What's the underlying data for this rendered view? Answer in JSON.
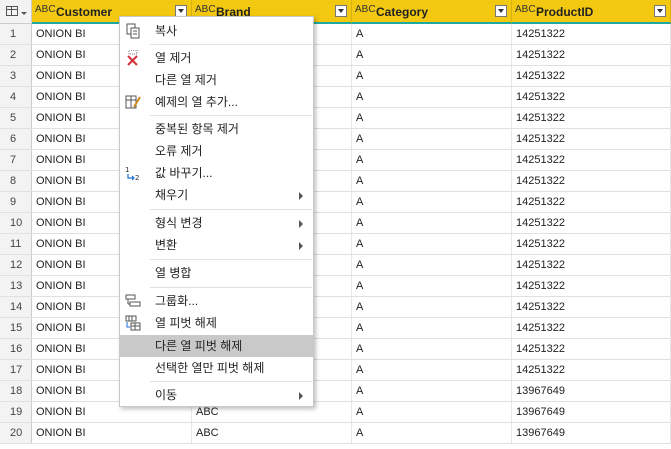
{
  "columns": [
    {
      "type": "ABC",
      "name": "Customer"
    },
    {
      "type": "ABC",
      "name": "Brand"
    },
    {
      "type": "ABC",
      "name": "Category"
    },
    {
      "type": "ABC",
      "name": "ProductID"
    }
  ],
  "rows": [
    [
      "1",
      "ONION BI",
      "",
      "A",
      "14251322"
    ],
    [
      "2",
      "ONION BI",
      "",
      "A",
      "14251322"
    ],
    [
      "3",
      "ONION BI",
      "",
      "A",
      "14251322"
    ],
    [
      "4",
      "ONION BI",
      "",
      "A",
      "14251322"
    ],
    [
      "5",
      "ONION BI",
      "",
      "A",
      "14251322"
    ],
    [
      "6",
      "ONION BI",
      "",
      "A",
      "14251322"
    ],
    [
      "7",
      "ONION BI",
      "",
      "A",
      "14251322"
    ],
    [
      "8",
      "ONION BI",
      "",
      "A",
      "14251322"
    ],
    [
      "9",
      "ONION BI",
      "",
      "A",
      "14251322"
    ],
    [
      "10",
      "ONION BI",
      "",
      "A",
      "14251322"
    ],
    [
      "11",
      "ONION BI",
      "",
      "A",
      "14251322"
    ],
    [
      "12",
      "ONION BI",
      "",
      "A",
      "14251322"
    ],
    [
      "13",
      "ONION BI",
      "",
      "A",
      "14251322"
    ],
    [
      "14",
      "ONION BI",
      "",
      "A",
      "14251322"
    ],
    [
      "15",
      "ONION BI",
      "",
      "A",
      "14251322"
    ],
    [
      "16",
      "ONION BI",
      "",
      "A",
      "14251322"
    ],
    [
      "17",
      "ONION BI",
      "",
      "A",
      "14251322"
    ],
    [
      "18",
      "ONION BI",
      "",
      "A",
      "13967649"
    ],
    [
      "19",
      "ONION BI",
      "ABC",
      "A",
      "13967649"
    ],
    [
      "20",
      "ONION BI",
      "ABC",
      "A",
      "13967649"
    ]
  ],
  "menu": {
    "items": [
      {
        "label": "복사",
        "icon": "copy-icon",
        "submenu": false,
        "highlighted": false
      },
      {
        "label": "열 제거",
        "icon": "remove-column-icon",
        "submenu": false,
        "highlighted": false
      },
      {
        "label": "다른 열 제거",
        "icon": "",
        "submenu": false,
        "highlighted": false
      },
      {
        "label": "예제의 열 추가...",
        "icon": "column-from-examples-icon",
        "submenu": false,
        "highlighted": false
      },
      {
        "label": "중복된 항목 제거",
        "icon": "",
        "submenu": false,
        "highlighted": false
      },
      {
        "label": "오류 제거",
        "icon": "",
        "submenu": false,
        "highlighted": false
      },
      {
        "label": "값 바꾸기...",
        "icon": "replace-values-icon",
        "submenu": false,
        "highlighted": false
      },
      {
        "label": "채우기",
        "icon": "",
        "submenu": true,
        "highlighted": false
      },
      {
        "label": "형식 변경",
        "icon": "",
        "submenu": true,
        "highlighted": false
      },
      {
        "label": "변환",
        "icon": "",
        "submenu": true,
        "highlighted": false
      },
      {
        "label": "열 병합",
        "icon": "",
        "submenu": false,
        "highlighted": false
      },
      {
        "label": "그룹화...",
        "icon": "group-by-icon",
        "submenu": false,
        "highlighted": false
      },
      {
        "label": "열 피벗 해제",
        "icon": "unpivot-icon",
        "submenu": false,
        "highlighted": false
      },
      {
        "label": "다른 열 피벗 해제",
        "icon": "",
        "submenu": false,
        "highlighted": true
      },
      {
        "label": "선택한 열만 피벗 해제",
        "icon": "",
        "submenu": false,
        "highlighted": false
      },
      {
        "label": "이동",
        "icon": "",
        "submenu": true,
        "highlighted": false
      }
    ]
  },
  "colors": {
    "header": "#f2c811",
    "highlight": "#c9c9c9",
    "accent": "#1ea9a0"
  }
}
